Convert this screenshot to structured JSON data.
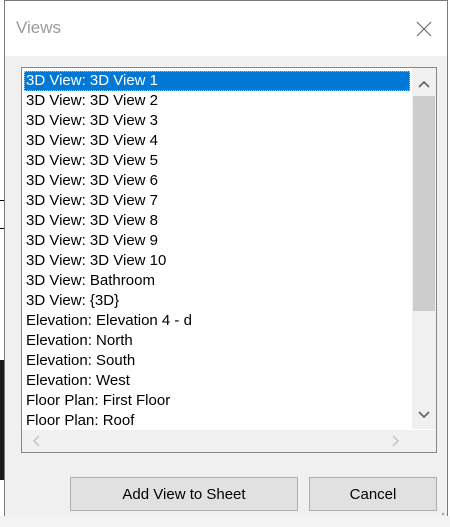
{
  "window": {
    "title": "Views",
    "close_symbol": "×"
  },
  "views_list": {
    "selected_index": 0,
    "items": [
      "3D View: 3D View 1",
      "3D View: 3D View 2",
      "3D View: 3D View 3",
      "3D View: 3D View 4",
      "3D View: 3D View 5",
      "3D View: 3D View 6",
      "3D View: 3D View 7",
      "3D View: 3D View 8",
      "3D View: 3D View 9",
      "3D View: 3D View 10",
      "3D View: Bathroom",
      "3D View: {3D}",
      "Elevation: Elevation 4 - d",
      "Elevation: North",
      "Elevation: South",
      "Elevation: West",
      "Floor Plan: First Floor",
      "Floor Plan: Roof"
    ]
  },
  "buttons": {
    "add_view": "Add View to Sheet",
    "cancel": "Cancel"
  },
  "colors": {
    "selection": "#0078d7",
    "dialog_bg": "#f0f0f0",
    "button_bg": "#e1e1e1"
  },
  "icons": {
    "close": "close-icon",
    "scroll_up": "chevron-up-icon",
    "scroll_down": "chevron-down-icon",
    "scroll_left": "chevron-left-icon",
    "scroll_right": "chevron-right-icon"
  }
}
